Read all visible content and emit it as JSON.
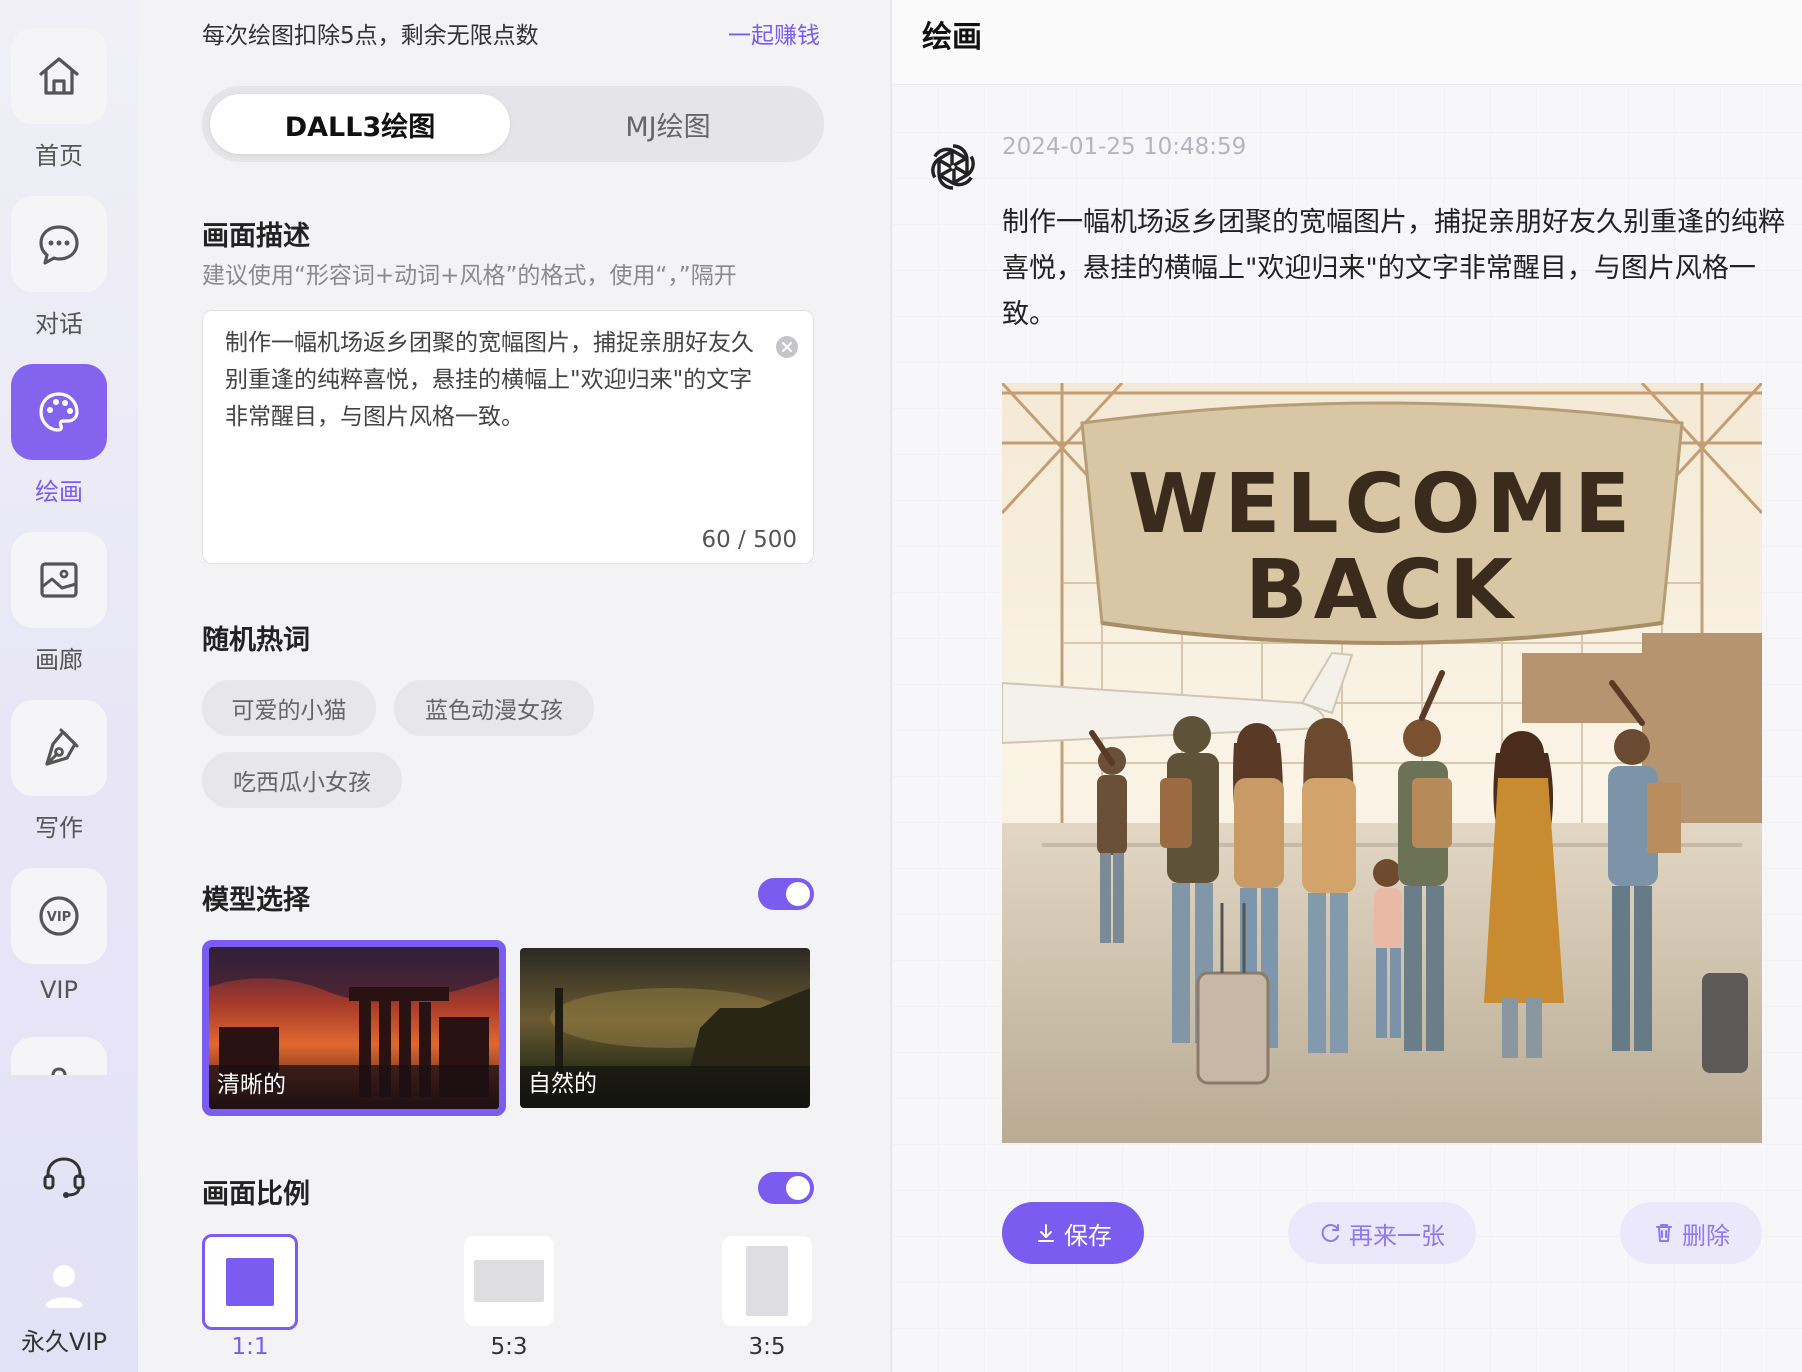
{
  "sidebar": {
    "items": [
      {
        "label": "首页",
        "icon": "home-icon"
      },
      {
        "label": "对话",
        "icon": "chat-icon"
      },
      {
        "label": "绘画",
        "icon": "palette-icon",
        "active": true
      },
      {
        "label": "画廊",
        "icon": "gallery-icon"
      },
      {
        "label": "写作",
        "icon": "pen-icon"
      },
      {
        "label": "VIP",
        "icon": "vip-icon",
        "icon_text": "VIP"
      }
    ],
    "support_icon": "headset-icon",
    "user": {
      "label": "永久VIP",
      "avatar_icon": "user-avatar-icon"
    }
  },
  "panel": {
    "notice": "每次绘图扣除5点，剩余无限点数",
    "earn_link": "一起赚钱",
    "mode_tabs": [
      {
        "label": "DALL3绘图",
        "selected": true
      },
      {
        "label": "MJ绘图",
        "selected": false
      }
    ],
    "description": {
      "title": "画面描述",
      "hint": "建议使用“形容词+动词+风格”的格式，使用“，”隔开",
      "value": "制作一幅机场返乡团聚的宽幅图片，捕捉亲朋好友久别重逢的纯粹喜悦，悬挂的横幅上\"欢迎归来\"的文字非常醒目，与图片风格一致。",
      "counter": "60 / 500"
    },
    "hot_words": {
      "title": "随机热词",
      "chips": [
        "可爱的小猫",
        "蓝色动漫女孩",
        "吃西瓜小女孩"
      ]
    },
    "model": {
      "title": "模型选择",
      "toggle_on": true,
      "options": [
        {
          "label": "清晰的",
          "selected": true
        },
        {
          "label": "自然的",
          "selected": false
        }
      ]
    },
    "ratio": {
      "title": "画面比例",
      "toggle_on": true,
      "options": [
        {
          "label": "1:1",
          "selected": true
        },
        {
          "label": "5:3",
          "selected": false
        },
        {
          "label": "3:5",
          "selected": false
        }
      ]
    }
  },
  "main": {
    "title": "绘画",
    "message": {
      "avatar_icon": "openai-logo-icon",
      "timestamp": "2024-01-25 10:48:59",
      "prompt": "制作一幅机场返乡团聚的宽幅图片，捕捉亲朋好友久别重逢的纯粹喜悦，悬挂的横幅上\"欢迎归来\"的文字非常醒目，与图片风格一致。",
      "image_banner": {
        "line1": "WELCOME",
        "line2": "BACK"
      }
    },
    "actions": {
      "save": "保存",
      "regenerate": "再来一张",
      "delete": "删除"
    }
  },
  "colors": {
    "accent": "#7a5cf0",
    "accent_light": "#ece8fc",
    "active_tile": "#8464ef"
  }
}
